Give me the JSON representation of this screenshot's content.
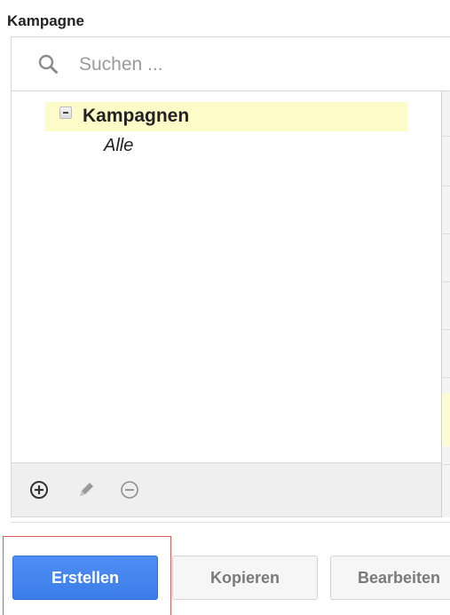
{
  "section": {
    "label": "Kampagne"
  },
  "search": {
    "placeholder": "Suchen ...",
    "value": ""
  },
  "tree": {
    "root_label": "Kampagnen",
    "root_state": "expanded",
    "children": [
      {
        "label": "Alle"
      }
    ],
    "highlight_color": "#fdfbc8"
  },
  "toolbar": {
    "icons": [
      {
        "name": "add-circle-icon"
      },
      {
        "name": "pencil-icon"
      },
      {
        "name": "remove-circle-icon"
      }
    ]
  },
  "buttons": {
    "create": "Erstellen",
    "copy": "Kopieren",
    "edit": "Bearbeiten"
  },
  "colors": {
    "primary": "#3b7de8",
    "highlight_border": "#e05a5a"
  }
}
